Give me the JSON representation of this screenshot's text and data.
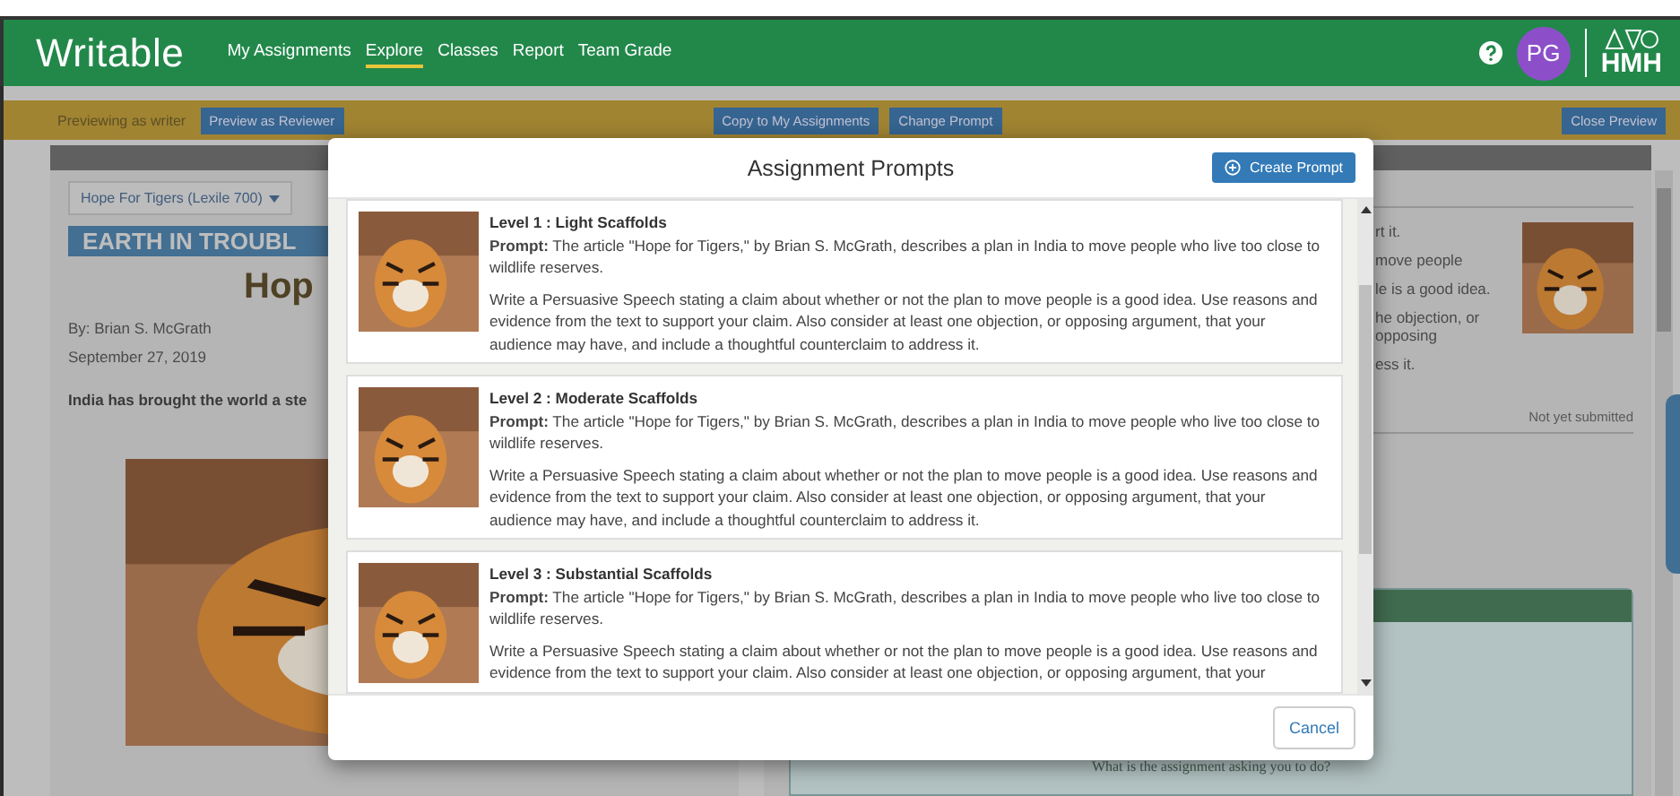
{
  "header": {
    "logo": "Writable",
    "nav": [
      {
        "label": "My Assignments",
        "selected": false
      },
      {
        "label": "Explore",
        "selected": true
      },
      {
        "label": "Classes",
        "selected": false
      },
      {
        "label": "Report",
        "selected": false
      },
      {
        "label": "Team Grade",
        "selected": false
      }
    ],
    "avatar": "PG",
    "brand": "HMH"
  },
  "preview_bar": {
    "status": "Previewing as writer",
    "reviewer_button": "Preview as Reviewer",
    "middle_buttons": [
      "Copy to My Assignments",
      "Change Prompt"
    ],
    "close_button": "Close Preview"
  },
  "article": {
    "selector": "Hope For Tigers (Lexile 700)",
    "banner": "EARTH IN TROUBL",
    "title": "Hop",
    "byline": "By: Brian S. McGrath",
    "date": "September 27, 2019",
    "lead": "India has brought the world a ste"
  },
  "side_panel": {
    "lines": [
      "rt it.",
      "move people",
      "le is a good idea.",
      "he objection, or opposing",
      "ess it."
    ],
    "status": "Not yet submitted",
    "question": "What is the assignment asking you to do?"
  },
  "modal": {
    "title": "Assignment Prompts",
    "create_button": "Create Prompt",
    "cancel_button": "Cancel",
    "prompts": [
      {
        "level": "Level 1 : Light Scaffolds",
        "prompt": "**Prompt:** The article \"Hope for Tigers,\" by Brian S. McGrath, describes a plan in India to move people who live too close to wildlife reserves.",
        "task": "Write a Persuasive Speech stating a claim about whether or not the plan to move people is a good idea. Use reasons and evidence from the text to support your claim. Also consider at least one objection, or opposing argument, that your audience may have, and include a thoughtful counterclaim to address it."
      },
      {
        "level": "Level 2 : Moderate Scaffolds",
        "prompt": "**Prompt:** The article \"Hope for Tigers,\" by Brian S. McGrath, describes a plan in India to move people who live too close to wildlife reserves.",
        "task": "Write a Persuasive Speech stating a claim about whether or not the plan to move people is a good idea. Use reasons and evidence from the text to support your claim. Also consider at least one objection, or opposing argument, that your audience may have, and include a thoughtful counterclaim to address it."
      },
      {
        "level": "Level 3 : Substantial Scaffolds",
        "prompt": "**Prompt:** The article \"Hope for Tigers,\" by Brian S. McGrath, describes a plan in India to move people who live too close to wildlife reserves.",
        "task": "Write a Persuasive Speech stating a claim about whether or not the plan to move people is a good idea. Use reasons and evidence from the text to support your claim. Also consider at least one objection, or opposing argument, that your"
      }
    ]
  }
}
